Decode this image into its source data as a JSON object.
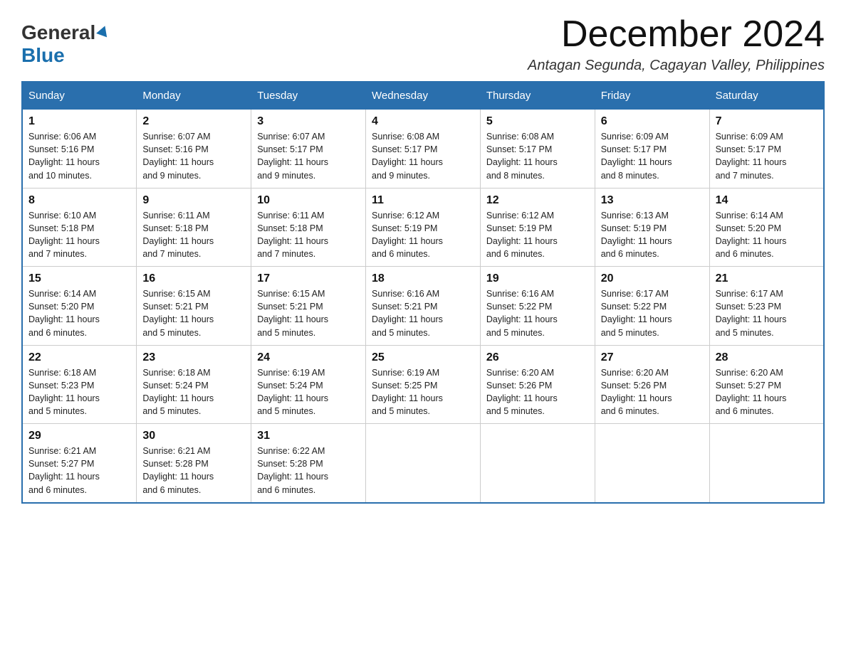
{
  "logo": {
    "general": "General",
    "blue": "Blue"
  },
  "header": {
    "month_year": "December 2024",
    "location": "Antagan Segunda, Cagayan Valley, Philippines"
  },
  "weekdays": [
    "Sunday",
    "Monday",
    "Tuesday",
    "Wednesday",
    "Thursday",
    "Friday",
    "Saturday"
  ],
  "weeks": [
    [
      {
        "day": "1",
        "sunrise": "6:06 AM",
        "sunset": "5:16 PM",
        "daylight": "11 hours and 10 minutes."
      },
      {
        "day": "2",
        "sunrise": "6:07 AM",
        "sunset": "5:16 PM",
        "daylight": "11 hours and 9 minutes."
      },
      {
        "day": "3",
        "sunrise": "6:07 AM",
        "sunset": "5:17 PM",
        "daylight": "11 hours and 9 minutes."
      },
      {
        "day": "4",
        "sunrise": "6:08 AM",
        "sunset": "5:17 PM",
        "daylight": "11 hours and 9 minutes."
      },
      {
        "day": "5",
        "sunrise": "6:08 AM",
        "sunset": "5:17 PM",
        "daylight": "11 hours and 8 minutes."
      },
      {
        "day": "6",
        "sunrise": "6:09 AM",
        "sunset": "5:17 PM",
        "daylight": "11 hours and 8 minutes."
      },
      {
        "day": "7",
        "sunrise": "6:09 AM",
        "sunset": "5:17 PM",
        "daylight": "11 hours and 7 minutes."
      }
    ],
    [
      {
        "day": "8",
        "sunrise": "6:10 AM",
        "sunset": "5:18 PM",
        "daylight": "11 hours and 7 minutes."
      },
      {
        "day": "9",
        "sunrise": "6:11 AM",
        "sunset": "5:18 PM",
        "daylight": "11 hours and 7 minutes."
      },
      {
        "day": "10",
        "sunrise": "6:11 AM",
        "sunset": "5:18 PM",
        "daylight": "11 hours and 7 minutes."
      },
      {
        "day": "11",
        "sunrise": "6:12 AM",
        "sunset": "5:19 PM",
        "daylight": "11 hours and 6 minutes."
      },
      {
        "day": "12",
        "sunrise": "6:12 AM",
        "sunset": "5:19 PM",
        "daylight": "11 hours and 6 minutes."
      },
      {
        "day": "13",
        "sunrise": "6:13 AM",
        "sunset": "5:19 PM",
        "daylight": "11 hours and 6 minutes."
      },
      {
        "day": "14",
        "sunrise": "6:14 AM",
        "sunset": "5:20 PM",
        "daylight": "11 hours and 6 minutes."
      }
    ],
    [
      {
        "day": "15",
        "sunrise": "6:14 AM",
        "sunset": "5:20 PM",
        "daylight": "11 hours and 6 minutes."
      },
      {
        "day": "16",
        "sunrise": "6:15 AM",
        "sunset": "5:21 PM",
        "daylight": "11 hours and 5 minutes."
      },
      {
        "day": "17",
        "sunrise": "6:15 AM",
        "sunset": "5:21 PM",
        "daylight": "11 hours and 5 minutes."
      },
      {
        "day": "18",
        "sunrise": "6:16 AM",
        "sunset": "5:21 PM",
        "daylight": "11 hours and 5 minutes."
      },
      {
        "day": "19",
        "sunrise": "6:16 AM",
        "sunset": "5:22 PM",
        "daylight": "11 hours and 5 minutes."
      },
      {
        "day": "20",
        "sunrise": "6:17 AM",
        "sunset": "5:22 PM",
        "daylight": "11 hours and 5 minutes."
      },
      {
        "day": "21",
        "sunrise": "6:17 AM",
        "sunset": "5:23 PM",
        "daylight": "11 hours and 5 minutes."
      }
    ],
    [
      {
        "day": "22",
        "sunrise": "6:18 AM",
        "sunset": "5:23 PM",
        "daylight": "11 hours and 5 minutes."
      },
      {
        "day": "23",
        "sunrise": "6:18 AM",
        "sunset": "5:24 PM",
        "daylight": "11 hours and 5 minutes."
      },
      {
        "day": "24",
        "sunrise": "6:19 AM",
        "sunset": "5:24 PM",
        "daylight": "11 hours and 5 minutes."
      },
      {
        "day": "25",
        "sunrise": "6:19 AM",
        "sunset": "5:25 PM",
        "daylight": "11 hours and 5 minutes."
      },
      {
        "day": "26",
        "sunrise": "6:20 AM",
        "sunset": "5:26 PM",
        "daylight": "11 hours and 5 minutes."
      },
      {
        "day": "27",
        "sunrise": "6:20 AM",
        "sunset": "5:26 PM",
        "daylight": "11 hours and 6 minutes."
      },
      {
        "day": "28",
        "sunrise": "6:20 AM",
        "sunset": "5:27 PM",
        "daylight": "11 hours and 6 minutes."
      }
    ],
    [
      {
        "day": "29",
        "sunrise": "6:21 AM",
        "sunset": "5:27 PM",
        "daylight": "11 hours and 6 minutes."
      },
      {
        "day": "30",
        "sunrise": "6:21 AM",
        "sunset": "5:28 PM",
        "daylight": "11 hours and 6 minutes."
      },
      {
        "day": "31",
        "sunrise": "6:22 AM",
        "sunset": "5:28 PM",
        "daylight": "11 hours and 6 minutes."
      },
      null,
      null,
      null,
      null
    ]
  ]
}
